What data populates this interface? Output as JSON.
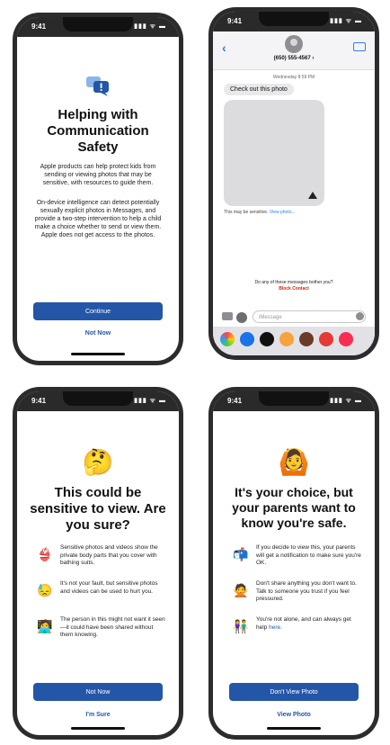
{
  "status": {
    "time": "9:41",
    "signal": "▮▮▮ ᯤ ▬"
  },
  "p1": {
    "icon": "chat-exclamation-icon",
    "title": "Helping with Communication Safety",
    "para1": "Apple products can help protect kids from sending or viewing photos that may be sensitive, with resources to guide them.",
    "para2": "On-device intelligence can detect potentially sexually explicit photos in Messages, and provide a two-step intervention to help a child make a choice whether to send or view them. Apple does not get access to the photos.",
    "continue": "Continue",
    "not_now": "Not Now"
  },
  "p2": {
    "contact": "(650) 555-4567 ›",
    "date": "Wednesday 8:59 PM",
    "bubble": "Check out this photo",
    "sensitive": "This may be sensitive.",
    "view_photo_link": "View photo...",
    "bother": "Do any of these messages bother you?",
    "block": "Block Contact",
    "input_placeholder": "iMessage"
  },
  "p3": {
    "emoji": "🤔",
    "title": "This could be sensitive to view. Are you sure?",
    "items": [
      {
        "icon": "👙",
        "text": "Sensitive photos and videos show the private body parts that you cover with bathing suits."
      },
      {
        "icon": "😓",
        "text": "It's not your fault, but sensitive photos and videos can be used to hurt you."
      },
      {
        "icon": "🧑‍💻",
        "text": "The person in this might not want it seen—it could have been shared without them knowing."
      }
    ],
    "not_now": "Not Now",
    "im_sure": "I'm Sure"
  },
  "p4": {
    "emoji": "🙆",
    "title": "It's your choice, but your parents want to know you're safe.",
    "items": [
      {
        "icon": "📬",
        "text": "If you decide to view this, your parents will get a notification to make sure you're OK.",
        "link": ""
      },
      {
        "icon": "🙅",
        "text": "Don't share anything you don't want to. Talk to someone you trust if you feel pressured.",
        "link": ""
      },
      {
        "icon": "👫",
        "text": "You're not alone, and can always get help ",
        "link": "here."
      }
    ],
    "dont_view": "Don't View Photo",
    "view_photo": "View Photo"
  },
  "colors": {
    "accent": "#2456a8",
    "link": "#2f7cf6",
    "danger": "#dd1111"
  }
}
